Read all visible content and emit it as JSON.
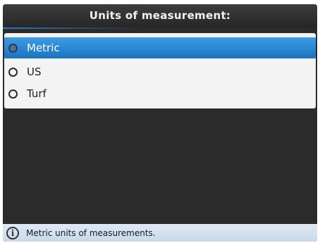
{
  "header": {
    "title": "Units of measurement:"
  },
  "options": [
    {
      "label": "Metric",
      "selected": true
    },
    {
      "label": "US",
      "selected": false
    },
    {
      "label": "Turf",
      "selected": false
    }
  ],
  "status": {
    "icon": "info-icon",
    "text": "Metric units of measurements."
  },
  "colors": {
    "selection": "#2a86d6",
    "titlebar": "#2b2b2b",
    "status_bg": "#d6e3f1"
  }
}
